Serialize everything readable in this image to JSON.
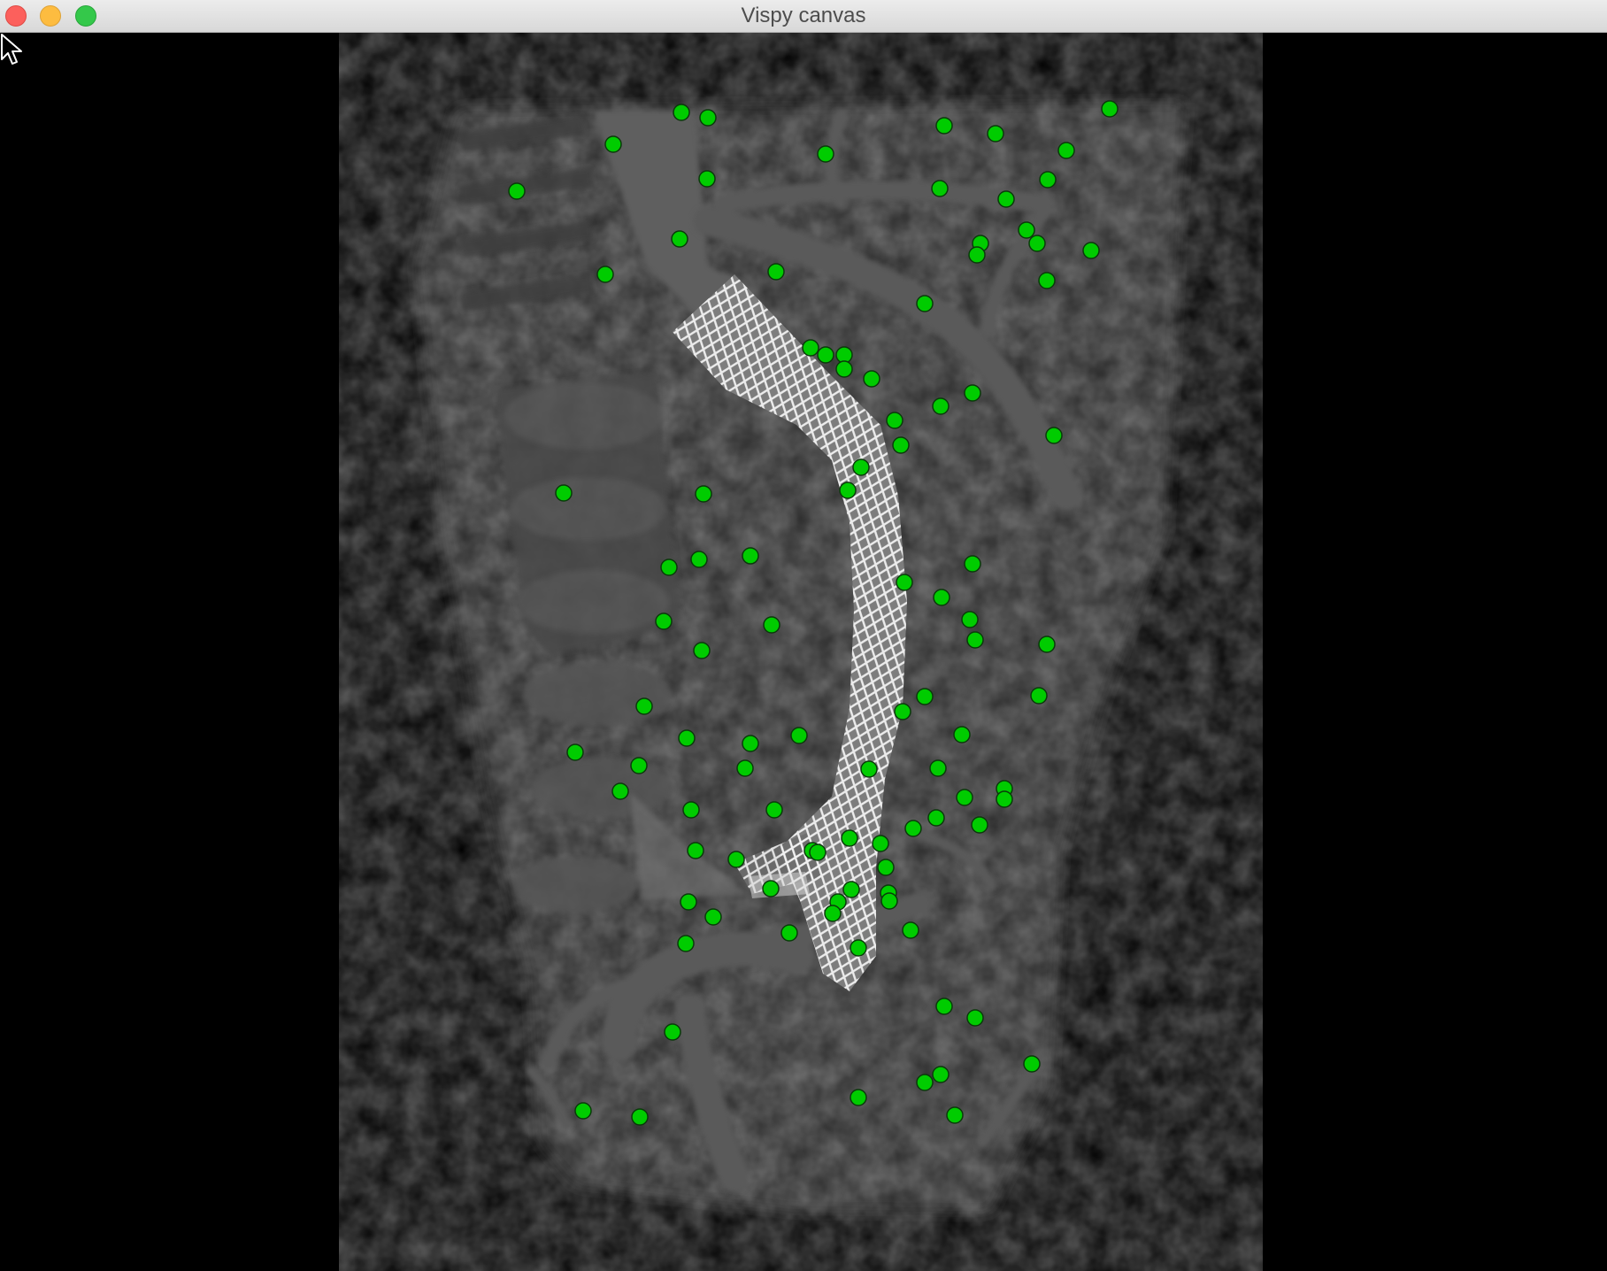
{
  "window": {
    "title": "Vispy canvas",
    "controls": [
      "close",
      "minimize",
      "zoom"
    ]
  },
  "volume": {
    "background_color": "#000000",
    "marker_color": "#00cc00",
    "marker_edge_color": "#0a3a0a"
  },
  "cursor": {
    "icon": "arrow-cursor-icon"
  }
}
